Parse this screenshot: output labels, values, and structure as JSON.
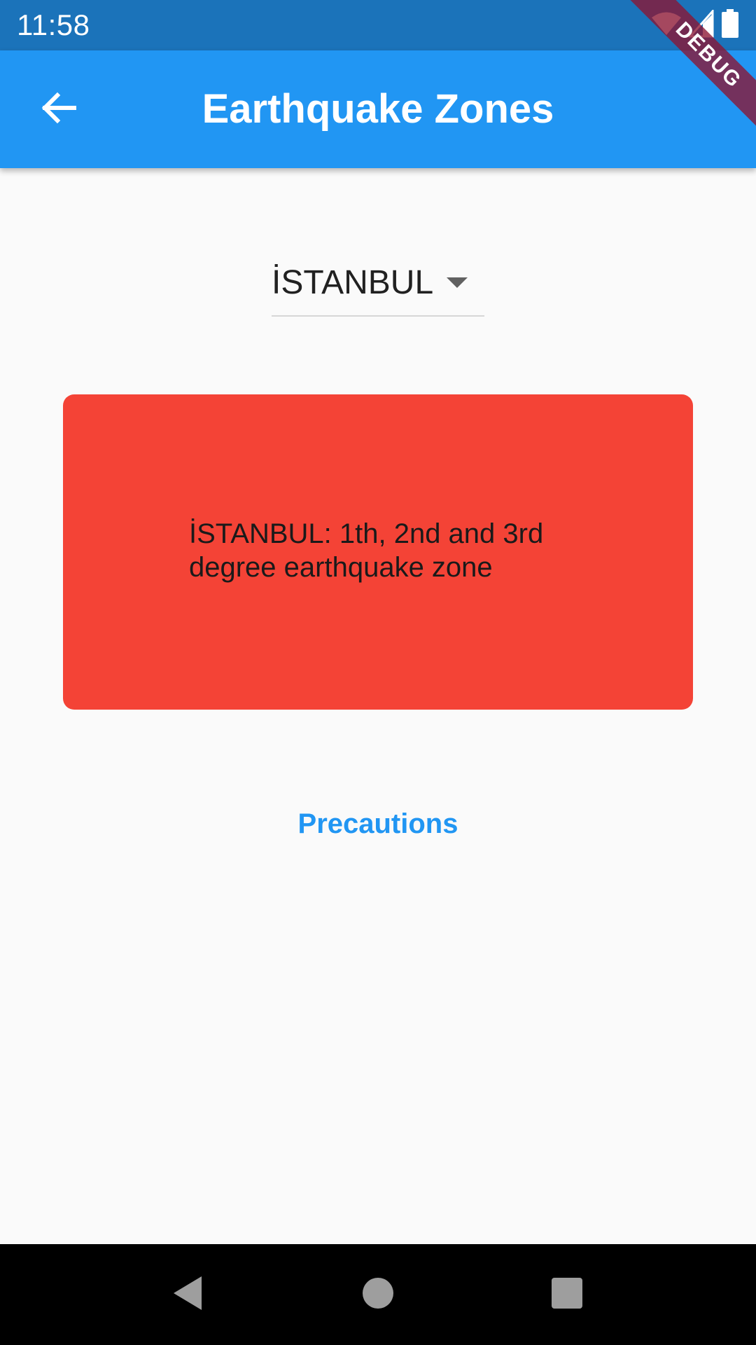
{
  "status_bar": {
    "time": "11:58",
    "icons": [
      "wifi-icon",
      "signal-icon",
      "battery-icon"
    ]
  },
  "app_bar": {
    "title": "Earthquake Zones",
    "back_icon": "arrow-back-icon",
    "color": "#2196f3"
  },
  "debug_banner": {
    "label": "DEBUG"
  },
  "dropdown": {
    "selected": "İSTANBUL",
    "icon": "arrow-drop-down-icon"
  },
  "zone_card": {
    "text": "İSTANBUL: 1th, 2nd and 3rd degree earthquake zone",
    "color": "#f44336"
  },
  "precautions_button": {
    "label": "Precautions",
    "color": "#2196f3"
  },
  "nav_bar": {
    "buttons": [
      "back-triangle-icon",
      "home-circle-icon",
      "recents-square-icon"
    ]
  }
}
